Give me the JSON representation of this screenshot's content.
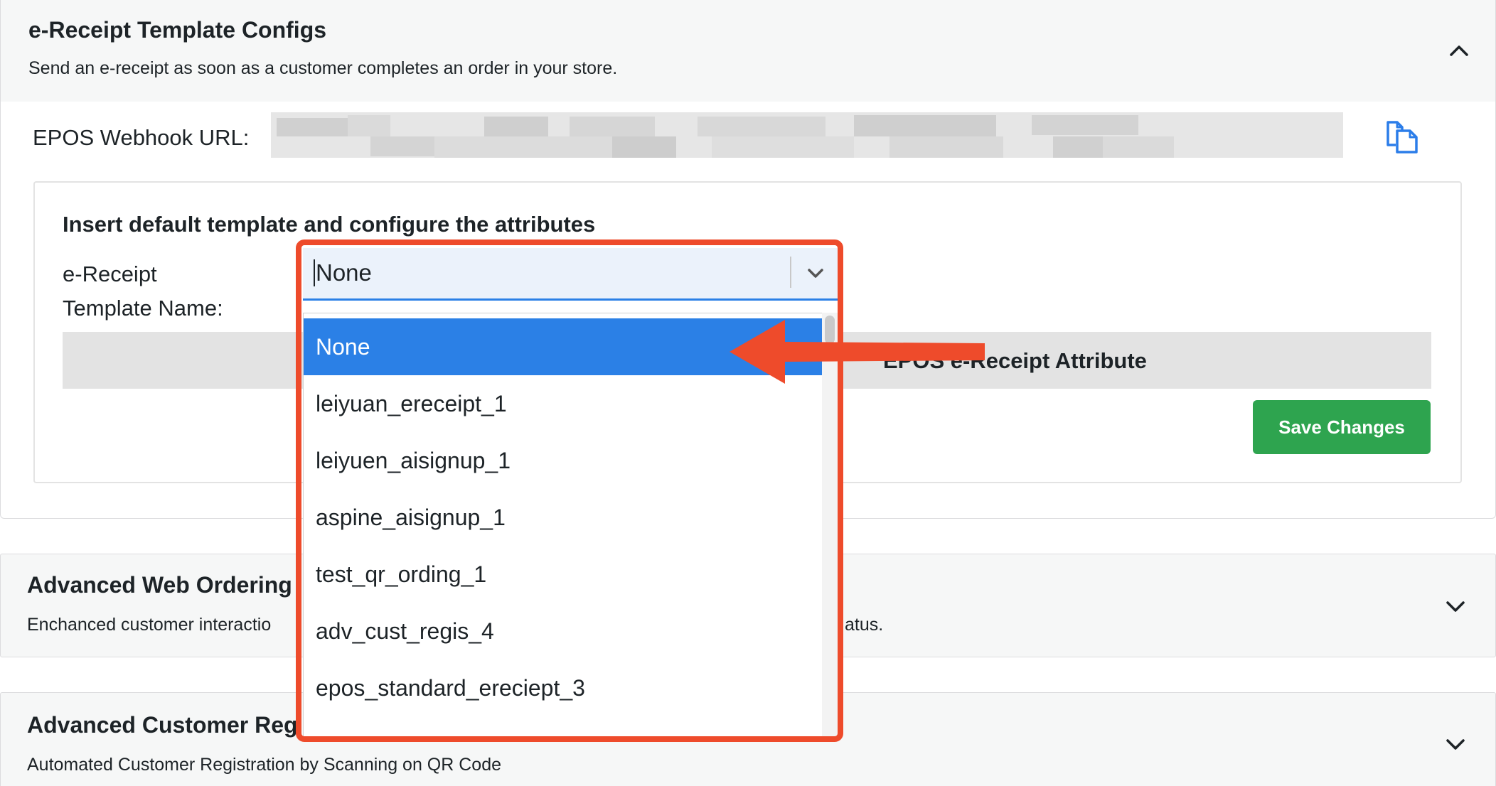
{
  "ereceipt_panel": {
    "title": "e-Receipt Template Configs",
    "description": "Send an e-receipt as soon as a customer completes an order in your store."
  },
  "webhook": {
    "label": "EPOS Webhook URL:",
    "value": ""
  },
  "template_config": {
    "heading": "Insert default template and configure the attributes",
    "template_label_line1": "e-Receipt",
    "template_label_line2": "Template Name:",
    "attribute_header_tail": "EPOS e-Receipt Attribute",
    "save_label": "Save Changes"
  },
  "template_select": {
    "selected": "None",
    "options": [
      "None",
      "leiyuan_ereceipt_1",
      "leiyuen_aisignup_1",
      "aspine_aisignup_1",
      "test_qr_ording_1",
      "adv_cust_regis_4",
      "epos_standard_ereciept_3"
    ]
  },
  "web_ordering_panel": {
    "title": "Advanced Web Ordering",
    "description": "Enchanced customer interactio",
    "description_tail": "atus."
  },
  "customer_reg_panel": {
    "title": "Advanced Customer Reg",
    "description": "Automated Customer Registration by Scanning on QR Code"
  },
  "colors": {
    "accent": "#2b80e6",
    "save": "#2ea44f",
    "annotation": "#ee4b2b",
    "copy_icon": "#2b7de9"
  },
  "icons": [
    "chevron-up-icon",
    "chevron-down-icon",
    "copy-icon"
  ]
}
